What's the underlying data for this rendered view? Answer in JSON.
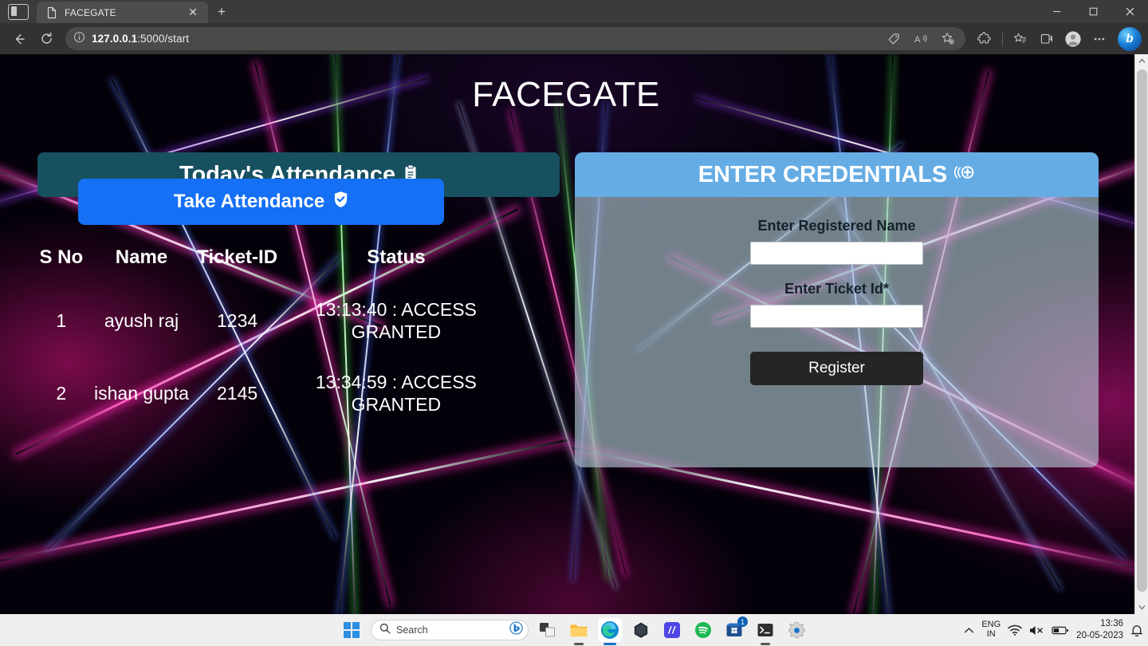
{
  "browser": {
    "tab": {
      "title": "FACEGATE",
      "favicon_icon": "page-icon",
      "close_icon": "✕"
    },
    "new_tab_icon": "+",
    "tab_search_icon": "tab-search-icon",
    "window_controls": {
      "minimize": "minimize-icon",
      "maximize": "maximize-icon",
      "close": "close-icon"
    },
    "toolbar": {
      "back_icon": "back-arrow-icon",
      "refresh_icon": "refresh-icon",
      "info_icon": "site-info-icon",
      "url_host": "127.0.0.1",
      "url_path": ":5000/start",
      "url_full": "127.0.0.1:5000/start",
      "right_icons": [
        {
          "name": "shopping-tag-icon",
          "glyph": "tag"
        },
        {
          "name": "read-aloud-icon",
          "glyph": "A-sound"
        },
        {
          "name": "add-favorite-icon",
          "glyph": "star-plus"
        },
        {
          "name": "extensions-icon",
          "glyph": "puzzle"
        },
        {
          "name": "collections-icon",
          "glyph": "star-list"
        },
        {
          "name": "browser-essentials-icon",
          "glyph": "split-screen"
        },
        {
          "name": "profile-icon",
          "glyph": "avatar"
        },
        {
          "name": "settings-and-more-icon",
          "glyph": "…"
        }
      ],
      "copilot_label": "b"
    }
  },
  "page": {
    "site_title": "FACEGATE",
    "attendance": {
      "header_title": "Today's Attendance",
      "header_icon": "clipboard-icon",
      "take_attendance_label": "Take Attendance",
      "take_attendance_icon": "shield-check-icon",
      "columns": [
        "S No",
        "Name",
        "Ticket-ID",
        "Status"
      ],
      "rows": [
        {
          "sno": "1",
          "name": "ayush raj",
          "ticket_id": "1234",
          "status": "13:13:40 : ACCESS GRANTED"
        },
        {
          "sno": "2",
          "name": "ishan gupta",
          "ticket_id": "2145",
          "status": "13:34:59 : ACCESS GRANTED"
        }
      ]
    },
    "credentials": {
      "header_title": "ENTER CREDENTIALS",
      "header_icon": "add-circle-icon",
      "name_label": "Enter Registered Name",
      "name_value": "",
      "name_placeholder": "",
      "ticket_label": "Enter Ticket Id*",
      "ticket_value": "",
      "ticket_placeholder": "",
      "register_label": "Register"
    },
    "colors": {
      "attendance_header": "#17505f",
      "credentials_header": "#65ace4",
      "primary_button": "#1570f5",
      "register_button": "#252525",
      "panel_body": "rgba(182,206,216,0.62)"
    }
  },
  "taskbar": {
    "start_icon": "windows-start-icon",
    "search_placeholder": "Search",
    "search_icon": "search-icon",
    "search_bing_icon": "bing-icon",
    "apps": [
      {
        "name": "task-view-icon",
        "label": "Task View"
      },
      {
        "name": "file-explorer-icon",
        "label": "File Explorer"
      },
      {
        "name": "microsoft-edge-icon",
        "label": "Microsoft Edge"
      },
      {
        "name": "gem-app-icon",
        "label": "App"
      },
      {
        "name": "m-app-icon",
        "label": "M"
      },
      {
        "name": "spotify-icon",
        "label": "Spotify"
      },
      {
        "name": "microsoft-store-icon",
        "label": "Microsoft Store",
        "badge": "1"
      },
      {
        "name": "terminal-icon",
        "label": "Terminal"
      },
      {
        "name": "settings-icon",
        "label": "Settings"
      }
    ],
    "tray": {
      "show_hidden_icon": "chevron-up-icon",
      "language_line1": "ENG",
      "language_line2": "IN",
      "wifi_icon": "wifi-icon",
      "volume_icon": "volume-muted-icon",
      "battery_icon": "battery-icon",
      "time": "13:36",
      "date": "20-05-2023",
      "notification_icon": "notification-bell-icon"
    }
  }
}
